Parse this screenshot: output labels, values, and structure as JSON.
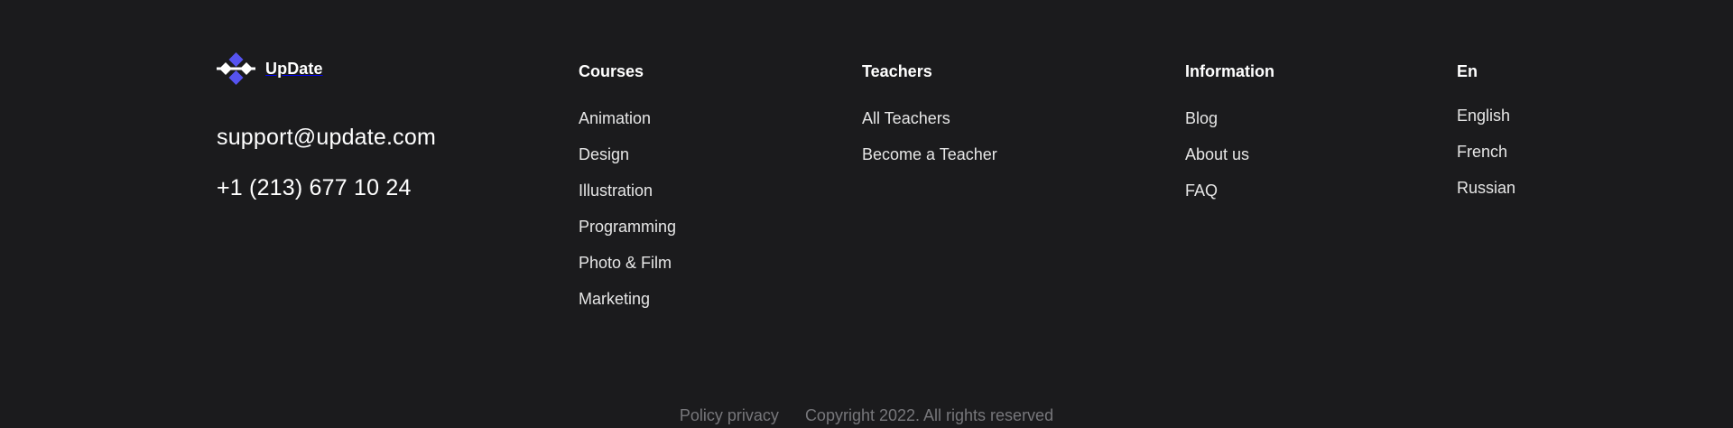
{
  "brand": {
    "name": "UpDate",
    "logo_colors": {
      "primary": "#5653f0",
      "accent": "#ffffff"
    }
  },
  "contact": {
    "email": "support@update.com",
    "phone": "+1 (213) 677 10 24"
  },
  "columns": {
    "courses": {
      "title": "Courses",
      "items": [
        "Animation",
        "Design",
        "Illustration",
        "Programming",
        "Photo & Film",
        "Marketing"
      ]
    },
    "teachers": {
      "title": "Teachers",
      "items": [
        "All Teachers",
        "Become a Teacher"
      ]
    },
    "information": {
      "title": "Information",
      "items": [
        "Blog",
        "About us",
        "FAQ"
      ]
    },
    "language": {
      "title": "En",
      "items": [
        "English",
        "French",
        "Russian"
      ]
    }
  },
  "bottom": {
    "policy": "Policy privacy",
    "copyright": "Copyright 2022. All rights reserved"
  },
  "colors": {
    "background": "#1b1b1d",
    "text": "#ffffff",
    "muted": "#77777b",
    "brand": "#5653f0"
  }
}
